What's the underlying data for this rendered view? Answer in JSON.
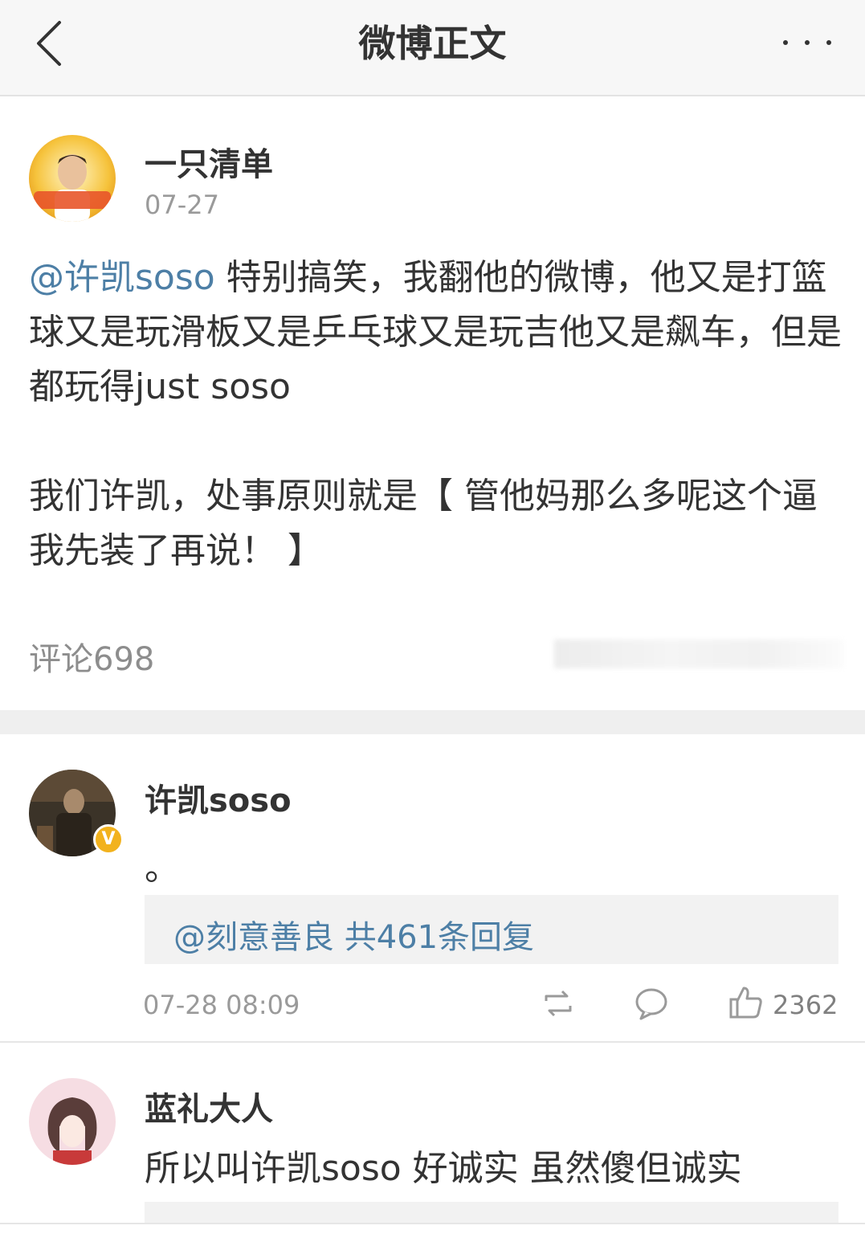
{
  "topbar": {
    "title": "微博正文",
    "back_icon": "chevron-left-icon",
    "more_icon": "more-horizontal-icon"
  },
  "post": {
    "author": "一只清单",
    "date": "07-27",
    "mention": "@许凯soso",
    "text_part1": " 特别搞笑，我翻他的微博，他又是打篮球又是玩滑板又是乒乓球又是玩吉他又是飙车，但是都玩得just soso",
    "text_part2": "我们许凯，处事原则就是【 管他妈那么多呢这个逼我先装了再说！ 】",
    "comment_count": "评论698"
  },
  "comments": [
    {
      "author": "许凯soso",
      "verified": "V",
      "text": "。",
      "reply_summary": "@刻意善良 共461条回复",
      "time": "07-28 08:09",
      "likes": "2362"
    },
    {
      "author": "蓝礼大人",
      "text": "所以叫许凯soso 好诚实 虽然傻但诚实"
    }
  ],
  "colors": {
    "link": "#4d7fa6",
    "badge": "#f2b21d",
    "section_gap": "#efefef"
  }
}
